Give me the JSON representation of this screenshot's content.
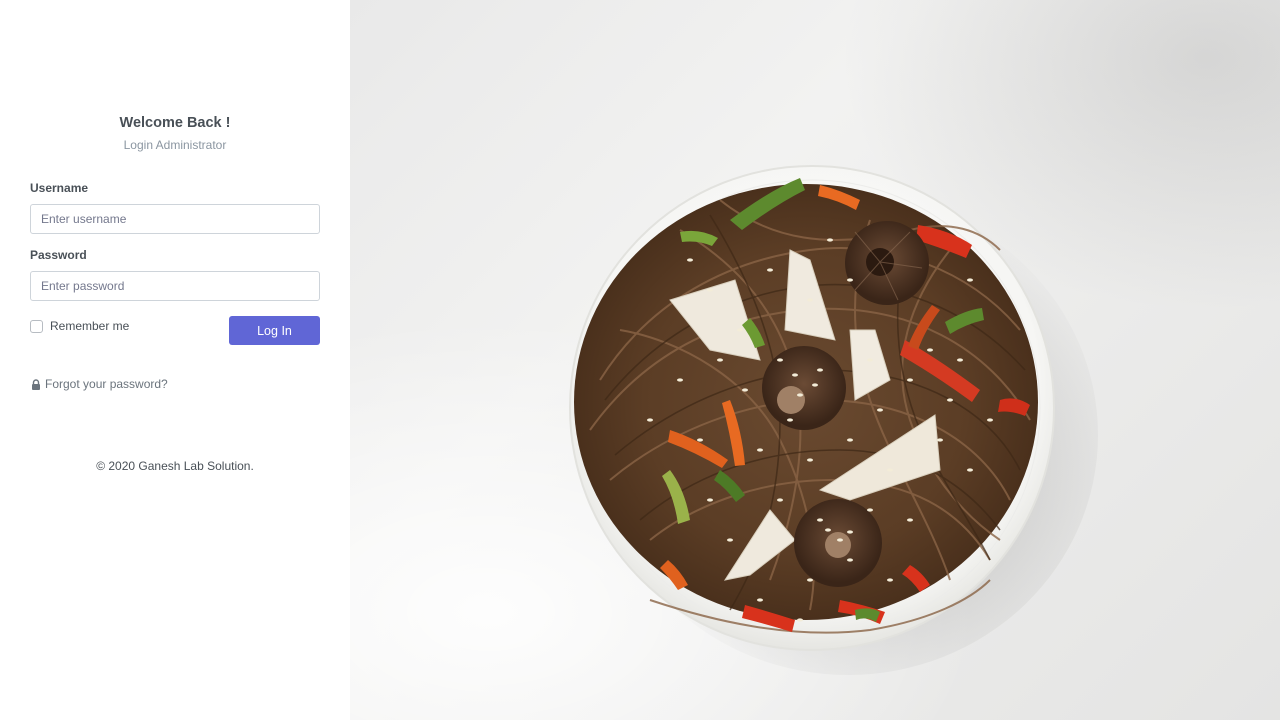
{
  "login": {
    "title": "Welcome Back !",
    "subtitle": "Login Administrator",
    "username_label": "Username",
    "username_placeholder": "Enter username",
    "username_value": "",
    "password_label": "Password",
    "password_placeholder": "Enter password",
    "password_value": "",
    "remember_label": "Remember me",
    "remember_checked": false,
    "login_button_label": "Log In",
    "forgot_link_text": "Forgot your password?",
    "forgot_icon": "lock-icon",
    "footer": "© 2020 Ganesh Lab Solution."
  },
  "hero": {
    "image_subject": "bowl of soba noodles with mushrooms and vegetables on marble",
    "icon": "food-image"
  },
  "colors": {
    "accent": "#6066d6",
    "text": "#495057",
    "muted": "#8b96a1"
  }
}
